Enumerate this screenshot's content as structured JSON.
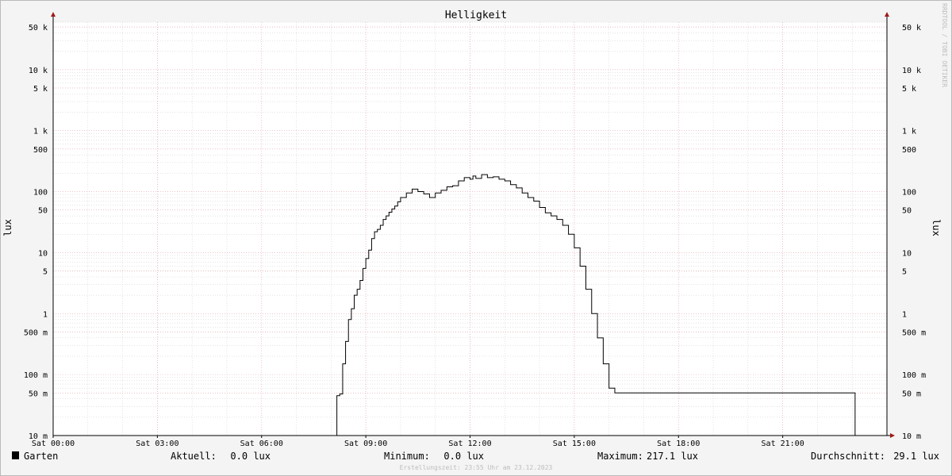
{
  "chart_data": {
    "type": "line",
    "title": "Helligkeit",
    "ylabel": "lux",
    "ylabel_right": "lux",
    "yscale": "log",
    "ylim": [
      0.01,
      60000
    ],
    "xlim": [
      "Sat 00:00",
      "Sat 24:00"
    ],
    "x_ticks": [
      "Sat 00:00",
      "Sat 03:00",
      "Sat 06:00",
      "Sat 09:00",
      "Sat 12:00",
      "Sat 15:00",
      "Sat 18:00",
      "Sat 21:00"
    ],
    "y_ticks": [
      {
        "value": 50000,
        "label": "50 k"
      },
      {
        "value": 10000,
        "label": "10 k"
      },
      {
        "value": 5000,
        "label": "5 k"
      },
      {
        "value": 1000,
        "label": "1 k"
      },
      {
        "value": 500,
        "label": "500"
      },
      {
        "value": 100,
        "label": "100"
      },
      {
        "value": 50,
        "label": "50"
      },
      {
        "value": 10,
        "label": "10"
      },
      {
        "value": 5,
        "label": "5"
      },
      {
        "value": 1,
        "label": "1"
      },
      {
        "value": 0.5,
        "label": "500 m"
      },
      {
        "value": 0.1,
        "label": "100 m"
      },
      {
        "value": 0.05,
        "label": "50 m"
      },
      {
        "value": 0.01,
        "label": "10 m"
      }
    ],
    "grid": true,
    "series": [
      {
        "name": "Garten",
        "color": "#000000",
        "x": [
          "07:55",
          "08:10",
          "08:15",
          "08:20",
          "08:25",
          "08:30",
          "08:35",
          "08:40",
          "08:45",
          "08:50",
          "08:55",
          "09:00",
          "09:05",
          "09:10",
          "09:15",
          "09:20",
          "09:25",
          "09:30",
          "09:35",
          "09:40",
          "09:45",
          "09:50",
          "09:55",
          "10:00",
          "10:10",
          "10:20",
          "10:30",
          "10:40",
          "10:50",
          "11:00",
          "11:10",
          "11:20",
          "11:30",
          "11:40",
          "11:50",
          "12:00",
          "12:05",
          "12:10",
          "12:20",
          "12:30",
          "12:40",
          "12:50",
          "13:00",
          "13:10",
          "13:20",
          "13:30",
          "13:40",
          "13:50",
          "14:00",
          "14:10",
          "14:20",
          "14:30",
          "14:40",
          "14:50",
          "15:00",
          "15:10",
          "15:20",
          "15:30",
          "15:40",
          "15:50",
          "16:00",
          "16:10",
          "16:15",
          "16:20",
          "16:25",
          "16:30",
          "16:35",
          "16:40",
          "16:45",
          "16:50",
          "16:55",
          "17:00",
          "17:05",
          "17:10",
          "17:15",
          "17:20",
          "23:00",
          "23:05"
        ],
        "values": [
          0.01,
          0.045,
          0.048,
          0.15,
          0.35,
          0.8,
          1.2,
          2.0,
          2.5,
          3.5,
          5.5,
          8.0,
          11.0,
          17.0,
          22.0,
          24.0,
          28.0,
          35.0,
          40.0,
          46.0,
          52.0,
          58.0,
          68.0,
          80.0,
          95.0,
          110.0,
          100.0,
          92.0,
          80.0,
          95.0,
          105.0,
          120.0,
          125.0,
          150.0,
          170.0,
          160.0,
          180.0,
          165.0,
          190.0,
          170.0,
          175.0,
          160.0,
          150.0,
          130.0,
          115.0,
          95.0,
          80.0,
          70.0,
          55.0,
          45.0,
          40.0,
          35.0,
          28.0,
          20.0,
          12.0,
          6.0,
          2.5,
          1.0,
          0.4,
          0.15,
          0.06,
          0.05,
          0.05,
          0.05,
          0.05,
          0.05,
          0.05,
          0.05,
          0.05,
          0.05,
          0.05,
          0.05,
          0.05,
          0.05,
          0.05,
          0.05,
          0.05,
          0.01
        ]
      }
    ],
    "legend": {
      "series_label": "Garten",
      "current_label": "Aktuell:",
      "current_value": "0.0 lux",
      "min_label": "Minimum:",
      "min_value": "0.0 lux",
      "max_label": "Maximum:",
      "max_value": "217.1 lux",
      "avg_label": "Durchschnitt:",
      "avg_value": "29.1 lux"
    },
    "footer": "Erstellungszeit: 23:55 Uhr am 23.12.2023",
    "watermark": "RRDTOOL / TOBI OETIKER",
    "colors": {
      "background": "#f4f4f4",
      "plot_background": "#ffffff",
      "minor_grid": "#c8c8c8",
      "major_grid": "#e6a0a6",
      "axis": "#000000",
      "arrow": "#a01818",
      "series": "#000000"
    }
  }
}
